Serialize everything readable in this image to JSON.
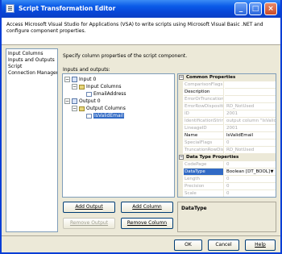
{
  "window": {
    "title": "Script Transformation Editor"
  },
  "title_buttons": {
    "minimize": "_",
    "maximize": "□",
    "close": "×"
  },
  "description": "Access Microsoft Visual Studio for Applications (VSA) to write scripts using Microsoft Visual Basic .NET and configure component properties.",
  "nav_items": [
    {
      "label": "Input Columns"
    },
    {
      "label": "Inputs and Outputs"
    },
    {
      "label": "Script"
    },
    {
      "label": "Connection Managers"
    }
  ],
  "page_caption": "Specify column properties of the script component.",
  "io_label": "Inputs and outputs:",
  "tree": {
    "input": "Input 0",
    "input_columns": "Input Columns",
    "input_col": "EmailAddress",
    "output": "Output 0",
    "output_columns": "Output Columns",
    "output_col": "IsValidEmail",
    "expanded_glyph": "−"
  },
  "buttons": {
    "add_output": "Add Output",
    "add_column": "Add Column",
    "remove_output": "Remove Output",
    "remove_column": "Remove Column",
    "ok": "OK",
    "cancel": "Cancel",
    "help": "Help"
  },
  "properties": {
    "common_header": "Common Properties",
    "common": [
      {
        "name": "ComparisonFlags",
        "value": "",
        "readonly": true
      },
      {
        "name": "Description",
        "value": "",
        "readonly": false
      },
      {
        "name": "ErrorOrTruncation",
        "value": "",
        "readonly": true
      },
      {
        "name": "ErrorRowDisposition",
        "value": "RD_NotUsed",
        "readonly": true
      },
      {
        "name": "ID",
        "value": "2001",
        "readonly": true
      },
      {
        "name": "IdentificationString",
        "value": "output column \"IsValidE",
        "readonly": true
      },
      {
        "name": "LineageID",
        "value": "2001",
        "readonly": true
      },
      {
        "name": "Name",
        "value": "IsValidEmail",
        "readonly": false
      },
      {
        "name": "SpecialFlags",
        "value": "0",
        "readonly": true
      },
      {
        "name": "TruncationRowDispo",
        "value": "RD_NotUsed",
        "readonly": true
      }
    ],
    "datatype_header": "Data Type Properties",
    "datatype": [
      {
        "name": "CodePage",
        "value": "0",
        "readonly": true
      },
      {
        "name": "DataType",
        "value": "Boolean [DT_BOOL]",
        "readonly": false,
        "selected": true
      },
      {
        "name": "Length",
        "value": "0",
        "readonly": true
      },
      {
        "name": "Precision",
        "value": "0",
        "readonly": true
      },
      {
        "name": "Scale",
        "value": "0",
        "readonly": true
      }
    ],
    "collapse_glyph": "−",
    "dropdown_glyph": "▼"
  },
  "property_description": "DataType"
}
